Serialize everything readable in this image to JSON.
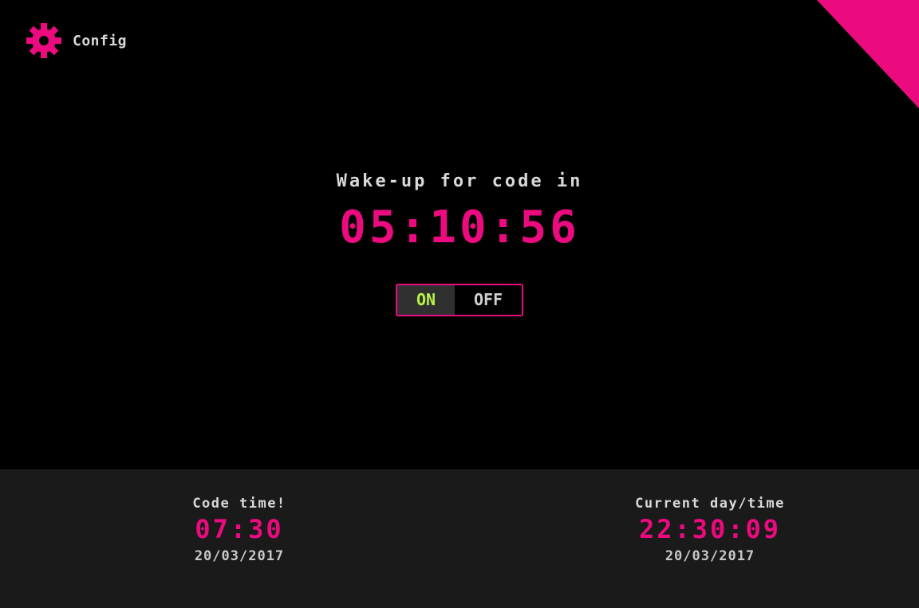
{
  "colors": {
    "background": "#000000",
    "accent": "#ec0a7f",
    "footer_bg": "#1a1a1a",
    "on_text": "#b6f24b",
    "label_text": "#d9d9d9"
  },
  "header": {
    "config_icon": "gear-icon",
    "config_label": "Config"
  },
  "main": {
    "wake_label": "Wake-up for code in",
    "countdown": "05:10:56",
    "toggle": {
      "on_label": "ON",
      "off_label": "OFF",
      "selected": "ON"
    }
  },
  "footer": {
    "code_time": {
      "title": "Code time!",
      "time": "07:30",
      "date": "20/03/2017"
    },
    "current": {
      "title": "Current day/time",
      "time": "22:30:09",
      "date": "20/03/2017"
    }
  }
}
